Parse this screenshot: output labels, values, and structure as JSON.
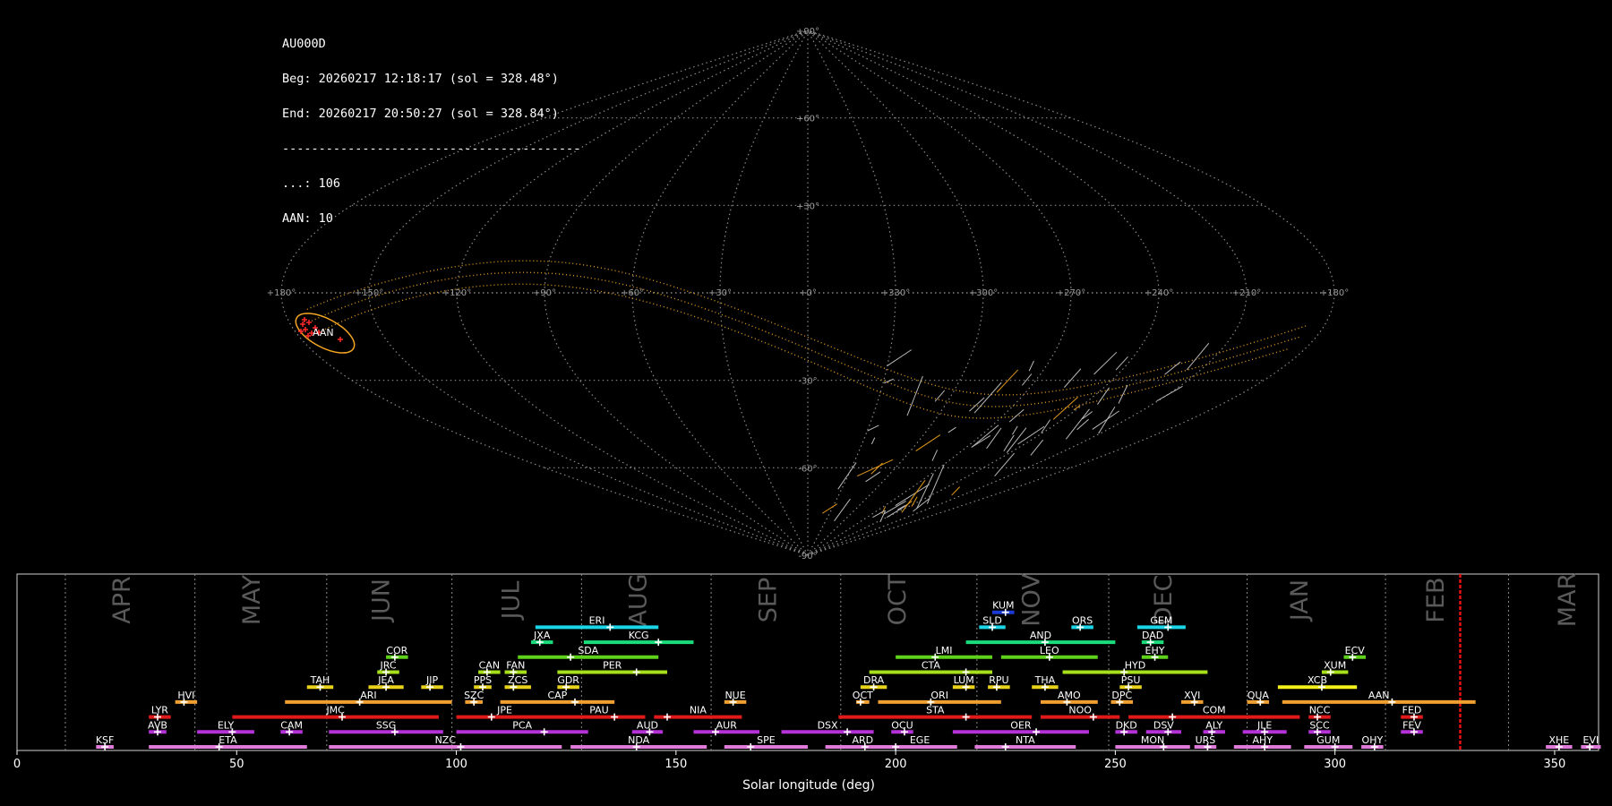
{
  "info": {
    "station": "AU000D",
    "begin": "Beg: 20260217 12:18:17 (sol = 328.48°)",
    "end": "End: 20260217 20:50:27 (sol = 328.84°)",
    "separator": "-----------------------------------------",
    "sporadic": "...: 106",
    "shower": "AAN: 10"
  },
  "sky_map": {
    "projection": "sinusoidal",
    "lon_labels": [
      "+180°",
      "+150°",
      "+120°",
      "+90°",
      "+60°",
      "+30°",
      "+0°",
      "+330°",
      "+300°",
      "+270°",
      "+240°",
      "+210°",
      "+180°"
    ],
    "lat_labels": [
      "+90°",
      "+60°",
      "+30°",
      "-30°",
      "-60°",
      "-90°"
    ],
    "shower_label": "AAN",
    "colors": {
      "grid": "#8a8a8a",
      "ecliptic": "#e0981a",
      "radiant_circle": "#f5a623",
      "radiants": "#ff2a2a",
      "tracks": "#b8b8b8"
    }
  },
  "chart_data": {
    "type": "timeline",
    "xlabel": "Solar longitude (deg)",
    "xlim": [
      0,
      360
    ],
    "xticks": [
      0,
      50,
      100,
      150,
      200,
      250,
      300,
      350
    ],
    "months": [
      {
        "name": "APR",
        "at": 24
      },
      {
        "name": "MAY",
        "at": 53.5
      },
      {
        "name": "JUN",
        "at": 83
      },
      {
        "name": "JUL",
        "at": 112.5
      },
      {
        "name": "AUG",
        "at": 141.5
      },
      {
        "name": "SEP",
        "at": 171
      },
      {
        "name": "OCT",
        "at": 200.5
      },
      {
        "name": "NOV",
        "at": 231
      },
      {
        "name": "DEC",
        "at": 261
      },
      {
        "name": "JAN",
        "at": 292
      },
      {
        "name": "FEB",
        "at": 323
      },
      {
        "name": "MAR",
        "at": 353
      }
    ],
    "month_boundaries": [
      11,
      40.5,
      70.5,
      99,
      128.5,
      158,
      187.5,
      218.5,
      248.5,
      280,
      311.5,
      339.5
    ],
    "current_solar_longitude": 328.5,
    "current_color": "#e81010",
    "showers": [
      {
        "code": "KSF",
        "start": 18,
        "end": 22,
        "peak": 20,
        "row": 0,
        "color": "#e07ad8"
      },
      {
        "code": "ETA",
        "start": 30,
        "end": 66,
        "peak": 46,
        "row": 0,
        "color": "#e07ad8"
      },
      {
        "code": "NZC",
        "start": 71,
        "end": 124,
        "peak": 101,
        "row": 0,
        "color": "#e07ad8"
      },
      {
        "code": "NDA",
        "start": 126,
        "end": 157,
        "peak": 141,
        "row": 0,
        "color": "#e07ad8"
      },
      {
        "code": "SPE",
        "start": 161,
        "end": 180,
        "peak": 167,
        "row": 0,
        "color": "#e07ad8"
      },
      {
        "code": "ARD",
        "start": 184,
        "end": 201,
        "peak": 193,
        "row": 0,
        "color": "#e07ad8"
      },
      {
        "code": "EGE",
        "start": 197,
        "end": 214,
        "peak": 200,
        "row": 0,
        "color": "#e07ad8"
      },
      {
        "code": "NTA",
        "start": 218,
        "end": 241,
        "peak": 225,
        "row": 0,
        "color": "#e07ad8"
      },
      {
        "code": "MON",
        "start": 250,
        "end": 267,
        "peak": 261,
        "row": 0,
        "color": "#e07ad8"
      },
      {
        "code": "URS",
        "start": 268,
        "end": 273,
        "peak": 271,
        "row": 0,
        "color": "#e07ad8"
      },
      {
        "code": "AHY",
        "start": 277,
        "end": 290,
        "peak": 284,
        "row": 0,
        "color": "#e07ad8"
      },
      {
        "code": "GUM",
        "start": 293,
        "end": 304,
        "peak": 300,
        "row": 0,
        "color": "#e07ad8"
      },
      {
        "code": "OHY",
        "start": 306,
        "end": 311,
        "peak": 309,
        "row": 0,
        "color": "#e07ad8"
      },
      {
        "code": "XHE",
        "start": 348,
        "end": 354,
        "peak": 351,
        "row": 0,
        "color": "#e07ad8"
      },
      {
        "code": "EVI",
        "start": 356,
        "end": 361,
        "peak": 358,
        "row": 0,
        "color": "#e07ad8"
      },
      {
        "code": "AVB",
        "start": 30,
        "end": 34,
        "peak": 32,
        "row": 1,
        "color": "#b531d8"
      },
      {
        "code": "ELY",
        "start": 41,
        "end": 54,
        "peak": 49,
        "row": 1,
        "color": "#b531d8"
      },
      {
        "code": "CAM",
        "start": 60,
        "end": 65,
        "peak": 62,
        "row": 1,
        "color": "#b531d8"
      },
      {
        "code": "SSG",
        "start": 71,
        "end": 97,
        "peak": 86,
        "row": 1,
        "color": "#b531d8"
      },
      {
        "code": "PCA",
        "start": 100,
        "end": 130,
        "peak": 120,
        "row": 1,
        "color": "#b531d8"
      },
      {
        "code": "AUD",
        "start": 140,
        "end": 147,
        "peak": 144,
        "row": 1,
        "color": "#b531d8"
      },
      {
        "code": "AUR",
        "start": 154,
        "end": 169,
        "peak": 159,
        "row": 1,
        "color": "#b531d8"
      },
      {
        "code": "DSX",
        "start": 174,
        "end": 195,
        "peak": 189,
        "row": 1,
        "color": "#b531d8"
      },
      {
        "code": "OCU",
        "start": 199,
        "end": 204,
        "peak": 202,
        "row": 1,
        "color": "#b531d8"
      },
      {
        "code": "OER",
        "start": 213,
        "end": 244,
        "peak": 232,
        "row": 1,
        "color": "#b531d8"
      },
      {
        "code": "DKD",
        "start": 250,
        "end": 255,
        "peak": 252,
        "row": 1,
        "color": "#b531d8"
      },
      {
        "code": "DSV",
        "start": 257,
        "end": 265,
        "peak": 262,
        "row": 1,
        "color": "#b531d8"
      },
      {
        "code": "ALY",
        "start": 270,
        "end": 275,
        "peak": 272,
        "row": 1,
        "color": "#b531d8"
      },
      {
        "code": "JLE",
        "start": 279,
        "end": 289,
        "peak": 284,
        "row": 1,
        "color": "#b531d8"
      },
      {
        "code": "SCC",
        "start": 294,
        "end": 299,
        "peak": 296,
        "row": 1,
        "color": "#b531d8"
      },
      {
        "code": "FEV",
        "start": 315,
        "end": 320,
        "peak": 318,
        "row": 1,
        "color": "#b531d8"
      },
      {
        "code": "LYR",
        "start": 30,
        "end": 35,
        "peak": 32,
        "row": 2,
        "color": "#e01a1a"
      },
      {
        "code": "JMC",
        "start": 49,
        "end": 96,
        "peak": 74,
        "row": 2,
        "color": "#e01a1a"
      },
      {
        "code": "JPE",
        "start": 100,
        "end": 122,
        "peak": 108,
        "row": 2,
        "color": "#e01a1a"
      },
      {
        "code": "PAU",
        "start": 122,
        "end": 143,
        "peak": 136,
        "row": 2,
        "color": "#e01a1a"
      },
      {
        "code": "NIA",
        "start": 145,
        "end": 165,
        "peak": 148,
        "row": 2,
        "color": "#e01a1a"
      },
      {
        "code": "STA",
        "start": 187,
        "end": 231,
        "peak": 216,
        "row": 2,
        "color": "#e01a1a"
      },
      {
        "code": "NOO",
        "start": 233,
        "end": 251,
        "peak": 245,
        "row": 2,
        "color": "#e01a1a"
      },
      {
        "code": "COM",
        "start": 253,
        "end": 292,
        "peak": 263,
        "row": 2,
        "color": "#e01a1a"
      },
      {
        "code": "NCC",
        "start": 294,
        "end": 299,
        "peak": 296,
        "row": 2,
        "color": "#e01a1a"
      },
      {
        "code": "FED",
        "start": 315,
        "end": 320,
        "peak": 318,
        "row": 2,
        "color": "#e01a1a"
      },
      {
        "code": "HVI",
        "start": 36,
        "end": 41,
        "peak": 38,
        "row": 3,
        "color": "#f0a030"
      },
      {
        "code": "ARI",
        "start": 61,
        "end": 99,
        "peak": 78,
        "row": 3,
        "color": "#f0a030"
      },
      {
        "code": "SZC",
        "start": 102,
        "end": 106,
        "peak": 104,
        "row": 3,
        "color": "#f0a030"
      },
      {
        "code": "CAP",
        "start": 110,
        "end": 136,
        "peak": 127,
        "row": 3,
        "color": "#f0a030"
      },
      {
        "code": "NUE",
        "start": 161,
        "end": 166,
        "peak": 163,
        "row": 3,
        "color": "#f0a030"
      },
      {
        "code": "OCT",
        "start": 191,
        "end": 194,
        "peak": 192,
        "row": 3,
        "color": "#f0a030"
      },
      {
        "code": "ORI",
        "start": 196,
        "end": 224,
        "peak": 208,
        "row": 3,
        "color": "#f0a030"
      },
      {
        "code": "AMO",
        "start": 233,
        "end": 246,
        "peak": 239,
        "row": 3,
        "color": "#f0a030"
      },
      {
        "code": "DPC",
        "start": 249,
        "end": 254,
        "peak": 251,
        "row": 3,
        "color": "#f0a030"
      },
      {
        "code": "XVI",
        "start": 265,
        "end": 270,
        "peak": 268,
        "row": 3,
        "color": "#f0a030"
      },
      {
        "code": "QUA",
        "start": 280,
        "end": 285,
        "peak": 283,
        "row": 3,
        "color": "#f0a030"
      },
      {
        "code": "AAN",
        "start": 288,
        "end": 332,
        "peak": 313,
        "row": 3,
        "color": "#f0a030"
      },
      {
        "code": "TAH",
        "start": 66,
        "end": 72,
        "peak": 69,
        "row": 4,
        "color": "#e8d21a"
      },
      {
        "code": "JEA",
        "start": 80,
        "end": 88,
        "peak": 84,
        "row": 4,
        "color": "#e8d21a"
      },
      {
        "code": "JIP",
        "start": 92,
        "end": 97,
        "peak": 94,
        "row": 4,
        "color": "#e8d21a"
      },
      {
        "code": "PPS",
        "start": 104,
        "end": 108,
        "peak": 106,
        "row": 4,
        "color": "#e8d21a"
      },
      {
        "code": "ZCS",
        "start": 111,
        "end": 117,
        "peak": 113,
        "row": 4,
        "color": "#e8d21a"
      },
      {
        "code": "GDR",
        "start": 123,
        "end": 128,
        "peak": 125,
        "row": 4,
        "color": "#e8d21a"
      },
      {
        "code": "DRA",
        "start": 192,
        "end": 198,
        "peak": 195,
        "row": 4,
        "color": "#e8d21a"
      },
      {
        "code": "LUM",
        "start": 213,
        "end": 218,
        "peak": 216,
        "row": 4,
        "color": "#e8d21a"
      },
      {
        "code": "RPU",
        "start": 221,
        "end": 226,
        "peak": 223,
        "row": 4,
        "color": "#e8d21a"
      },
      {
        "code": "THA",
        "start": 231,
        "end": 237,
        "peak": 234,
        "row": 4,
        "color": "#e8d21a"
      },
      {
        "code": "PSU",
        "start": 251,
        "end": 256,
        "peak": 253,
        "row": 4,
        "color": "#e8d21a"
      },
      {
        "code": "XCB",
        "start": 287,
        "end": 305,
        "peak": 297,
        "row": 4,
        "color": "#f4f01a"
      },
      {
        "code": "JRC",
        "start": 82,
        "end": 87,
        "peak": 84,
        "row": 5,
        "color": "#a6e01a"
      },
      {
        "code": "CAN",
        "start": 105,
        "end": 110,
        "peak": 107,
        "row": 5,
        "color": "#a6e01a"
      },
      {
        "code": "FAN",
        "start": 111,
        "end": 116,
        "peak": 113,
        "row": 5,
        "color": "#a6e01a"
      },
      {
        "code": "PER",
        "start": 123,
        "end": 148,
        "peak": 141,
        "row": 5,
        "color": "#a6e01a"
      },
      {
        "code": "CTA",
        "start": 194,
        "end": 222,
        "peak": 216,
        "row": 5,
        "color": "#a6e01a"
      },
      {
        "code": "HYD",
        "start": 238,
        "end": 271,
        "peak": 252,
        "row": 5,
        "color": "#a6e01a"
      },
      {
        "code": "XUM",
        "start": 297,
        "end": 303,
        "peak": 299,
        "row": 5,
        "color": "#a6e01a"
      },
      {
        "code": "COR",
        "start": 84,
        "end": 89,
        "peak": 86,
        "row": 6,
        "color": "#5ed21a"
      },
      {
        "code": "SDA",
        "start": 114,
        "end": 146,
        "peak": 126,
        "row": 6,
        "color": "#5ed21a"
      },
      {
        "code": "LMI",
        "start": 200,
        "end": 222,
        "peak": 209,
        "row": 6,
        "color": "#5ed21a"
      },
      {
        "code": "LEO",
        "start": 224,
        "end": 246,
        "peak": 235,
        "row": 6,
        "color": "#5ed21a"
      },
      {
        "code": "EHY",
        "start": 256,
        "end": 262,
        "peak": 259,
        "row": 6,
        "color": "#5ed21a"
      },
      {
        "code": "ECV",
        "start": 302,
        "end": 307,
        "peak": 304,
        "row": 6,
        "color": "#5ed21a"
      },
      {
        "code": "JXA",
        "start": 117,
        "end": 122,
        "peak": 119,
        "row": 7,
        "color": "#1adc7a"
      },
      {
        "code": "KCG",
        "start": 129,
        "end": 154,
        "peak": 146,
        "row": 7,
        "color": "#1adc7a"
      },
      {
        "code": "AND",
        "start": 216,
        "end": 250,
        "peak": 234,
        "row": 7,
        "color": "#1adc7a"
      },
      {
        "code": "DAD",
        "start": 256,
        "end": 261,
        "peak": 258,
        "row": 7,
        "color": "#1adc7a"
      },
      {
        "code": "ERI",
        "start": 118,
        "end": 146,
        "peak": 135,
        "row": 8,
        "color": "#1ad6e8"
      },
      {
        "code": "SLD",
        "start": 219,
        "end": 225,
        "peak": 222,
        "row": 8,
        "color": "#1ad6e8"
      },
      {
        "code": "ORS",
        "start": 240,
        "end": 245,
        "peak": 242,
        "row": 8,
        "color": "#1ad6e8"
      },
      {
        "code": "GEM",
        "start": 255,
        "end": 266,
        "peak": 262,
        "row": 8,
        "color": "#1ad6e8"
      },
      {
        "code": "KUM",
        "start": 222,
        "end": 227,
        "peak": 225,
        "row": 9,
        "color": "#1a3ad6"
      }
    ]
  }
}
